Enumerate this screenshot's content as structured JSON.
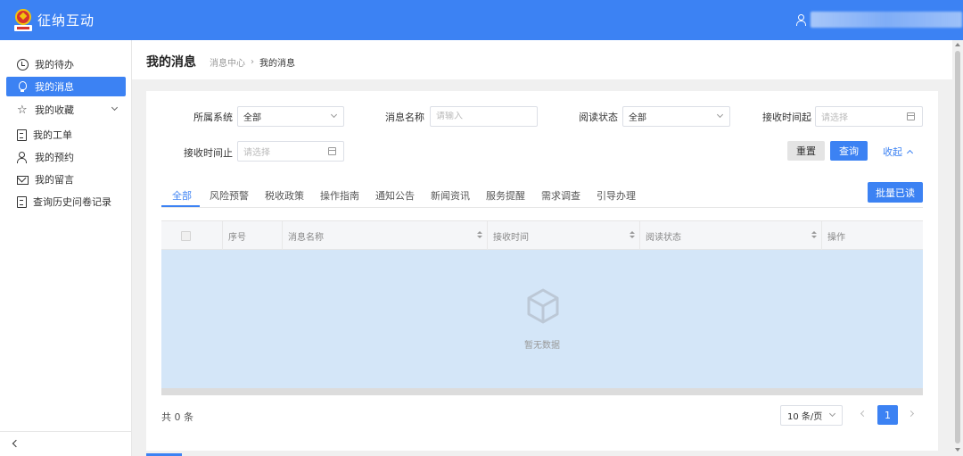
{
  "header": {
    "title": "征纳互动"
  },
  "sidebar": {
    "items": [
      {
        "label": "我的待办",
        "icon": "clock-icon"
      },
      {
        "label": "我的消息",
        "icon": "bulb-icon"
      },
      {
        "label": "我的收藏",
        "icon": "star-icon"
      },
      {
        "label": "我的工单",
        "icon": "document-icon"
      },
      {
        "label": "我的预约",
        "icon": "person-icon"
      },
      {
        "label": "我的留言",
        "icon": "mail-icon"
      },
      {
        "label": "查询历史问卷记录",
        "icon": "document-icon"
      }
    ]
  },
  "page": {
    "title": "我的消息",
    "breadcrumb": {
      "parent": "消息中心",
      "current": "我的消息"
    }
  },
  "filters": {
    "system": {
      "label": "所属系统",
      "value": "全部"
    },
    "message_name": {
      "label": "消息名称",
      "placeholder": "请输入"
    },
    "read_status": {
      "label": "阅读状态",
      "value": "全部"
    },
    "receive_start": {
      "label": "接收时间起",
      "placeholder": "请选择"
    },
    "receive_end": {
      "label": "接收时间止",
      "placeholder": "请选择"
    },
    "reset_label": "重置",
    "search_label": "查询",
    "collapse_label": "收起"
  },
  "tabs": [
    {
      "label": "全部",
      "active": true
    },
    {
      "label": "风险预警"
    },
    {
      "label": "税收政策"
    },
    {
      "label": "操作指南"
    },
    {
      "label": "通知公告"
    },
    {
      "label": "新闻资讯"
    },
    {
      "label": "服务提醒"
    },
    {
      "label": "需求调查"
    },
    {
      "label": "引导办理"
    }
  ],
  "batch_read_label": "批量已读",
  "table": {
    "columns": [
      "序号",
      "消息名称",
      "接收时间",
      "阅读状态",
      "操作"
    ],
    "empty_text": "暂无数据"
  },
  "pagination": {
    "total_text": "共 0 条",
    "page_size": "10 条/页",
    "current_page": "1"
  },
  "colors": {
    "primary": "#3c82f3",
    "empty_bg": "#d4e6f8"
  }
}
